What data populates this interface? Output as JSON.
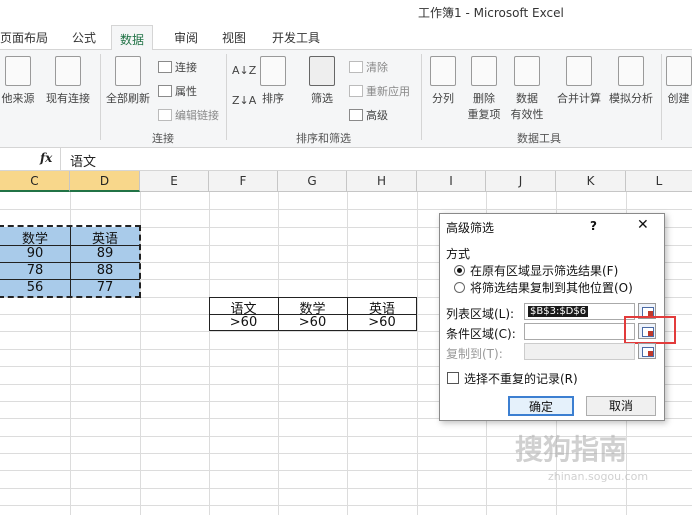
{
  "window": {
    "title": "工作簿1 - Microsoft Excel"
  },
  "tabs": [
    {
      "label": "页面布局"
    },
    {
      "label": "公式"
    },
    {
      "label": "数据"
    },
    {
      "label": "审阅"
    },
    {
      "label": "视图"
    },
    {
      "label": "开发工具"
    }
  ],
  "ribbon": {
    "from_other": "他来源",
    "existing": "现有连接",
    "refresh_all": "全部刷新",
    "connections": "连接",
    "properties": "属性",
    "edit_links": "编辑链接",
    "group_connections": "连接",
    "sort_az": "A↓Z",
    "sort_za": "Z↓A",
    "sort": "排序",
    "filter": "筛选",
    "clear": "清除",
    "reapply": "重新应用",
    "advanced": "高级",
    "group_sort_filter": "排序和筛选",
    "text_to_columns": "分列",
    "remove_dup_1": "删除",
    "remove_dup_2": "重复项",
    "validation_1": "数据",
    "validation_2": "有效性",
    "consolidate": "合并计算",
    "what_if": "模拟分析",
    "create": "创建",
    "group_data_tools": "数据工具"
  },
  "formula_bar": {
    "fx": "fx",
    "value": "语文"
  },
  "columns": [
    "C",
    "D",
    "E",
    "F",
    "G",
    "H",
    "I",
    "J",
    "K",
    "L"
  ],
  "data_table": {
    "headers": [
      "数学",
      "英语"
    ],
    "rows": [
      [
        "90",
        "89"
      ],
      [
        "78",
        "88"
      ],
      [
        "56",
        "77"
      ]
    ]
  },
  "criteria_table": {
    "headers": [
      "语文",
      "数学",
      "英语"
    ],
    "values": [
      ">60",
      ">60",
      ">60"
    ]
  },
  "dialog": {
    "title": "高级筛选",
    "help": "?",
    "close": "✕",
    "mode_label": "方式",
    "option1": "在原有区域显示筛选结果(F)",
    "option2": "将筛选结果复制到其他位置(O)",
    "list_label": "列表区域(L):",
    "list_value": "$B$3:$D$6",
    "criteria_label": "条件区域(C):",
    "criteria_value": "",
    "copyto_label": "复制到(T):",
    "copyto_value": "",
    "unique_label": "选择不重复的记录(R)",
    "ok": "确定",
    "cancel": "取消"
  },
  "watermark": {
    "line1": "搜狗指南",
    "line2": "zhinan.sogou.com"
  },
  "colors": {
    "accent": "#217346",
    "selected_cells": "#a9cbea",
    "highlight_box": "#e23b3b"
  }
}
